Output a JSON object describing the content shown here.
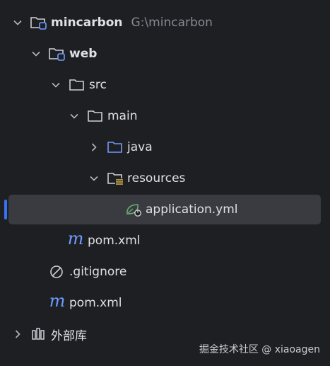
{
  "tree": {
    "root": {
      "name": "mincarbon",
      "path": "G:\\mincarbon"
    },
    "web": {
      "name": "web"
    },
    "src": {
      "name": "src"
    },
    "main": {
      "name": "main"
    },
    "java": {
      "name": "java"
    },
    "resources": {
      "name": "resources"
    },
    "application": {
      "name": "application.yml"
    },
    "web_pom": {
      "name": "pom.xml"
    },
    "gitignore": {
      "name": ".gitignore"
    },
    "root_pom": {
      "name": "pom.xml"
    },
    "external": {
      "name": "外部库"
    }
  },
  "watermark": "掘金技术社区 @ xiaoagen",
  "colors": {
    "background": "#1e1f22",
    "selection": "#393b40",
    "accent": "#3574f0",
    "folder_blue": "#6e9cff",
    "spring_green": "#6aab73"
  }
}
